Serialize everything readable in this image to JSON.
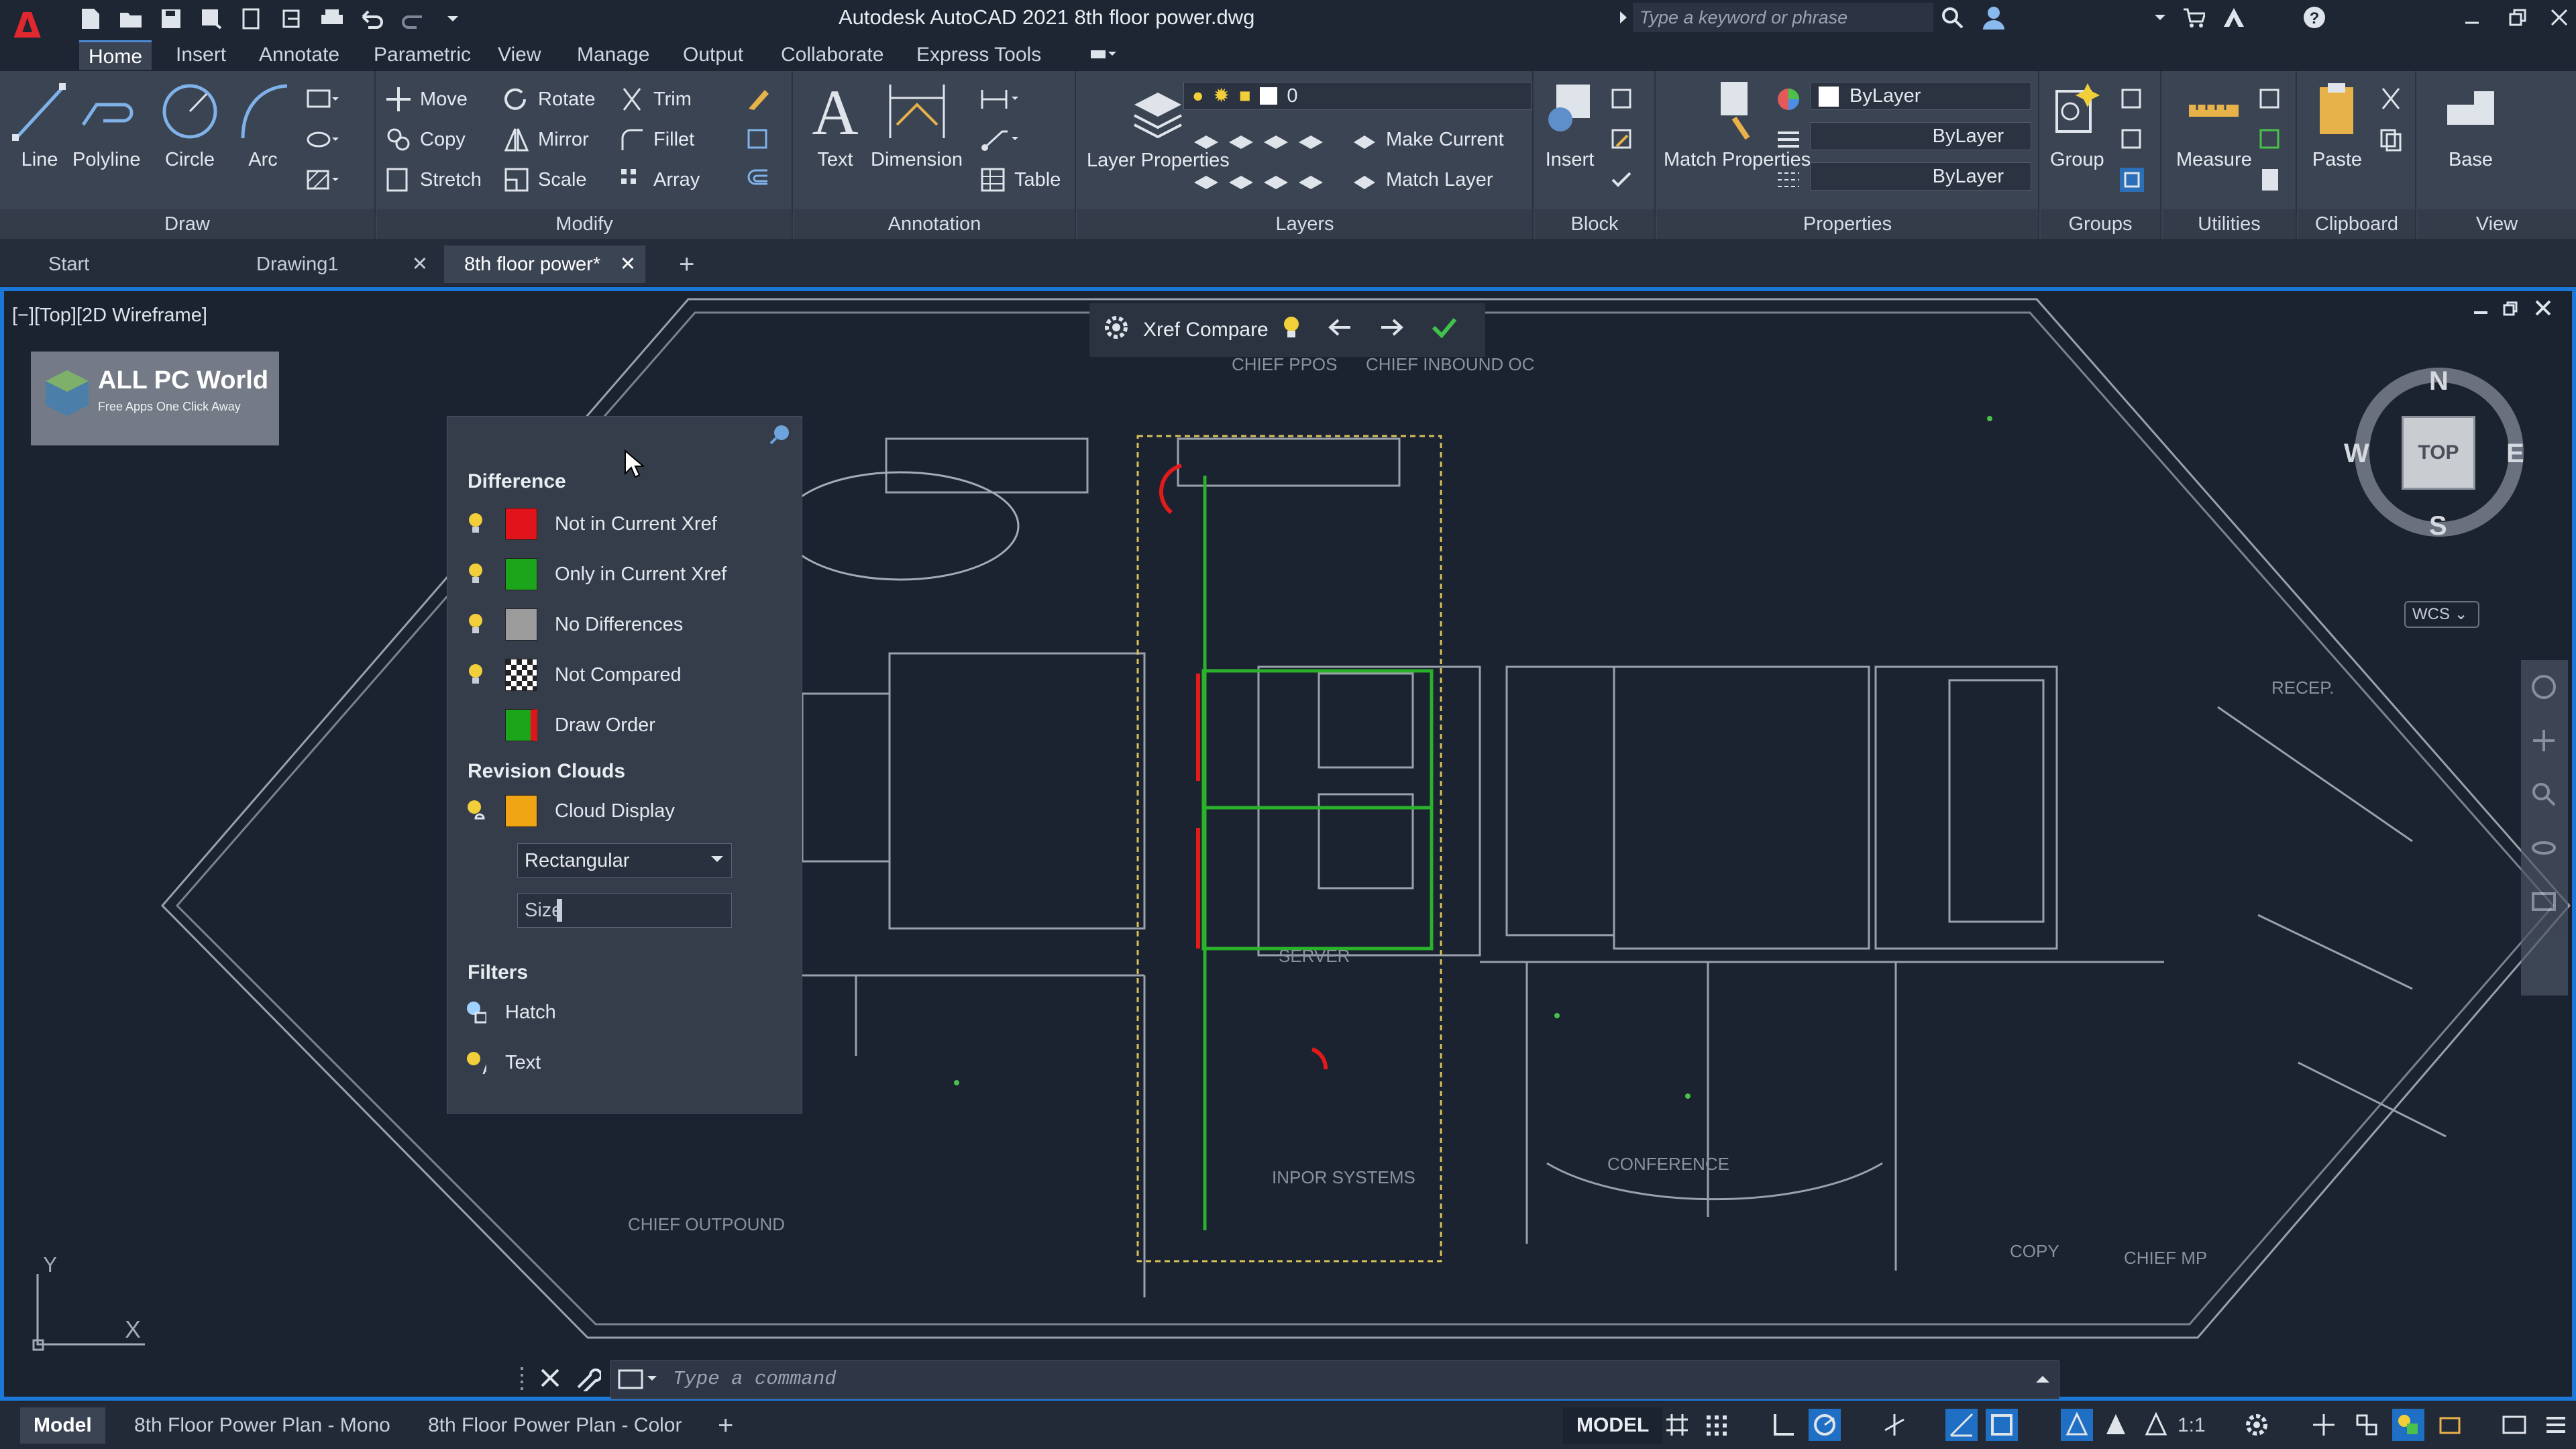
{
  "window": {
    "title": "Autodesk AutoCAD 2021   8th floor power.dwg",
    "search_placeholder": "Type a keyword or phrase",
    "logo_letter": "A"
  },
  "ribbon_tabs": [
    "Home",
    "Insert",
    "Annotate",
    "Parametric",
    "View",
    "Manage",
    "Output",
    "Collaborate",
    "Express Tools"
  ],
  "ribbon": {
    "draw": {
      "title": "Draw",
      "line": "Line",
      "polyline": "Polyline",
      "circle": "Circle",
      "arc": "Arc"
    },
    "modify": {
      "title": "Modify",
      "move": "Move",
      "rotate": "Rotate",
      "trim": "Trim",
      "copy": "Copy",
      "mirror": "Mirror",
      "fillet": "Fillet",
      "stretch": "Stretch",
      "scale": "Scale",
      "array": "Array"
    },
    "annotation": {
      "title": "Annotation",
      "text": "Text",
      "dimension": "Dimension",
      "table": "Table"
    },
    "layers": {
      "title": "Layers",
      "layer_properties": "Layer Properties",
      "current_layer": "0",
      "make_current": "Make Current",
      "match_layer": "Match Layer"
    },
    "block": {
      "title": "Block",
      "insert": "Insert"
    },
    "properties": {
      "title": "Properties",
      "match_properties": "Match Properties",
      "color": "ByLayer",
      "linetype": "ByLayer",
      "lineweight": "ByLayer"
    },
    "groups": {
      "title": "Groups",
      "group": "Group"
    },
    "utilities": {
      "title": "Utilities",
      "measure": "Measure"
    },
    "clipboard": {
      "title": "Clipboard",
      "paste": "Paste"
    },
    "view": {
      "title": "View",
      "base": "Base"
    }
  },
  "doc_tabs": [
    "Start",
    "Drawing1",
    "8th floor power*"
  ],
  "viewport": {
    "label": "[−][Top][2D Wireframe]",
    "watermark_title": "ALL PC World",
    "watermark_sub": "Free Apps One Click Away",
    "xref_compare": "Xref Compare",
    "viewcube": {
      "n": "N",
      "s": "S",
      "e": "E",
      "w": "W",
      "top": "TOP",
      "wcs": "WCS"
    },
    "ucs": {
      "x": "X",
      "y": "Y"
    }
  },
  "palette": {
    "difference_heading": "Difference",
    "items": [
      {
        "label": "Not in Current Xref",
        "color": "#e0141a"
      },
      {
        "label": "Only in Current Xref",
        "color": "#1aa51a"
      },
      {
        "label": "No Differences",
        "color": "#9b9b9b"
      },
      {
        "label": "Not Compared",
        "color": "checker"
      },
      {
        "label": "Draw Order",
        "color": "#1aa51a"
      }
    ],
    "revision_heading": "Revision Clouds",
    "cloud_display": "Cloud Display",
    "cloud_color": "#f0a514",
    "cloud_shape": "Rectangular",
    "size_label": "Size",
    "filters_heading": "Filters",
    "hatch": "Hatch",
    "text": "Text"
  },
  "plan_labels": [
    "CHIEF PPOS",
    "CHIEF INBOUND OC",
    "SERVER",
    "INPOR SYSTEMS",
    "CONFERENCE",
    "CHIEF OUTPOUND",
    "COPY",
    "CHIEF MP",
    "RECEP."
  ],
  "command_placeholder": "Type  a  command",
  "layout_tabs": [
    "Model",
    "8th Floor Power Plan - Mono",
    "8th Floor Power Plan - Color"
  ],
  "status": {
    "model": "MODEL",
    "scale": "1:1"
  }
}
